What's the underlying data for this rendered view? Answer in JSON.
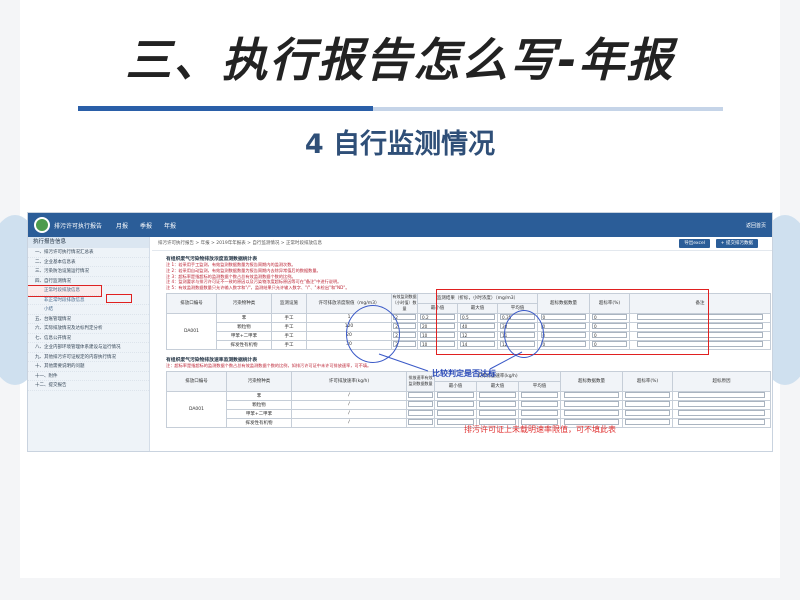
{
  "slide": {
    "title": "三、执行报告怎么写-年报",
    "subtitle": "4 自行监测情况"
  },
  "app": {
    "name": "排污许可执行报告",
    "nav": [
      "月报",
      "季报",
      "年报"
    ],
    "back": "返回首页",
    "breadcrumb": "排污许可执行报告 > 年报 > 2019年年报表 > 自行监测情况 > 正常时段排放信息",
    "buttons": {
      "export": "导出excel",
      "save": "+ 提交排污数据"
    }
  },
  "sidebar": {
    "header": "执行报告信息",
    "items": [
      {
        "label": "一、排污许可执行情况汇总表",
        "sub": false,
        "active": false
      },
      {
        "label": "二、企业基本信息表",
        "sub": false,
        "active": false
      },
      {
        "label": "三、污染防治设施运行情况",
        "sub": false,
        "active": false
      },
      {
        "label": "四、自行监测情况",
        "sub": false,
        "active": false
      },
      {
        "label": "正常时段排放信息",
        "sub": true,
        "active": true
      },
      {
        "label": "非正常时段排放信息",
        "sub": true,
        "active": false
      },
      {
        "label": "小结",
        "sub": true,
        "active": false
      },
      {
        "label": "五、台账管理情况",
        "sub": false,
        "active": false
      },
      {
        "label": "六、实际排放情况及达标判定分析",
        "sub": false,
        "active": false
      },
      {
        "label": "七、信息公开情况",
        "sub": false,
        "active": false
      },
      {
        "label": "八、企业内部环境管理体系建设与运行情况",
        "sub": false,
        "active": false
      },
      {
        "label": "九、其他排污许可证规定的内容执行情况",
        "sub": false,
        "active": false
      },
      {
        "label": "十、其他需要说明的问题",
        "sub": false,
        "active": false
      },
      {
        "label": "十一、附件",
        "sub": false,
        "active": false
      },
      {
        "label": "十二、提交报告",
        "sub": false,
        "active": false
      }
    ]
  },
  "table1": {
    "title": "有组织废气污染物排放浓度监测数据统计表",
    "notes": [
      "注 1：若采用手工监测，有效监测数据数量为报告周期内的监测次数。",
      "注 2：若采用自动监测，有效监测数据数量为报告周期内去除异常值后的数据数量。",
      "注 3：超标率是指超标的监测数据个数占总有效监测数据个数的比例。",
      "注 4：监测要求与排污许可证不一致的原因以及污染物浓度超标原因等可在\"备注\"中进行说明。",
      "注 5：有效监测数据数量只允许输入数字和\"/\"，监测结果只允许输入数字、\"/\"、\"未检出\"和\"ND\"。"
    ],
    "headers": {
      "outlet": "排放口编号",
      "pollutant": "污染物种类",
      "facility": "监测设施",
      "limit": "许可排放浓度限值（mg/m3）",
      "count": "有效监测数据（小时值）数量",
      "result": "监测结果（折标，小时浓度）（mg/m3）",
      "min": "最小值",
      "max": "最大值",
      "avg": "平均值",
      "exceed_count": "超标数据数量",
      "exceed_rate": "超标率(%)",
      "remark": "备注"
    },
    "outlet": "DA001",
    "rows": [
      {
        "pollutant": "苯",
        "facility": "手工",
        "limit": "1",
        "count": "2",
        "min": "0.2",
        "max": "0.5",
        "avg": "0.35",
        "exceed": "0",
        "rate": "0"
      },
      {
        "pollutant": "颗粒物",
        "facility": "手工",
        "limit": "120",
        "count": "2",
        "min": "20",
        "max": "40",
        "avg": "30",
        "exceed": "0",
        "rate": "0"
      },
      {
        "pollutant": "甲苯+二甲苯",
        "facility": "手工",
        "limit": "20",
        "count": "2",
        "min": "10",
        "max": "12",
        "avg": "11",
        "exceed": "0",
        "rate": "0"
      },
      {
        "pollutant": "挥发性有机物",
        "facility": "手工",
        "limit": "30",
        "count": "2",
        "min": "10",
        "max": "14",
        "avg": "12",
        "exceed": "0",
        "rate": "0"
      }
    ]
  },
  "table2": {
    "title": "有组织废气污染物排放速率监测数据统计表",
    "note": "注：超标率是指超标的监测数据个数占总有效监测数据个数的比例，如排污许可证中未许可排放速率，可不填。",
    "headers": {
      "outlet": "排放口编号",
      "pollutant": "污染物种类",
      "limit": "许可排放速率(kg/h)",
      "count": "排放速率有效监测数据数量",
      "result": "实际排放速率(kg/h)",
      "min": "最小值",
      "max": "最大值",
      "avg": "平均值",
      "exceed_count": "超标数据数量",
      "exceed_rate": "超标率(%)",
      "reason": "超标原因"
    },
    "outlet": "DA001",
    "rows": [
      {
        "pollutant": "苯",
        "limit": "/"
      },
      {
        "pollutant": "颗粒物",
        "limit": "/"
      },
      {
        "pollutant": "甲苯+二甲苯",
        "limit": "/"
      },
      {
        "pollutant": "挥发性有机物",
        "limit": "/"
      }
    ]
  },
  "annotations": {
    "compare": "比较判定是否达标",
    "rate_note": "排污许可证上未载明速率限值，可不填此表"
  }
}
